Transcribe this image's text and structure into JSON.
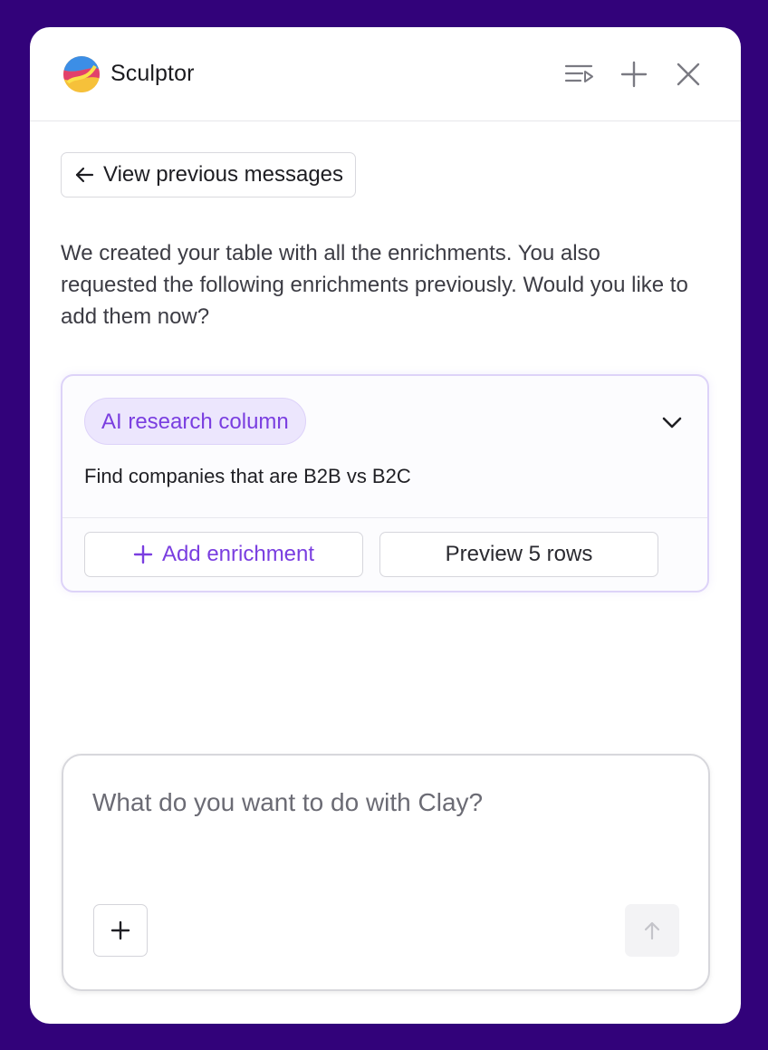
{
  "app": {
    "title": "Sculptor",
    "logo_icon": "sculptor-logo-icon"
  },
  "header": {
    "actions": [
      {
        "name": "history-icon"
      },
      {
        "name": "plus-icon"
      },
      {
        "name": "close-icon"
      }
    ]
  },
  "nav": {
    "back_label": "View previous messages",
    "back_icon": "arrow-left-icon"
  },
  "message": {
    "text": "We created your table with all the enrichments. You also requested the following enrichments previously. Would you like to add them now?"
  },
  "enrichment_card": {
    "tag": "AI research column",
    "description": "Find companies that are B2B vs B2C",
    "add_label": "Add enrichment",
    "preview_label": "Preview 5 rows"
  },
  "composer": {
    "placeholder": "What do you want to do with Clay?",
    "value": ""
  },
  "colors": {
    "background": "#32027a",
    "accent": "#7a3ee0",
    "pill_bg": "#ece6fd"
  }
}
